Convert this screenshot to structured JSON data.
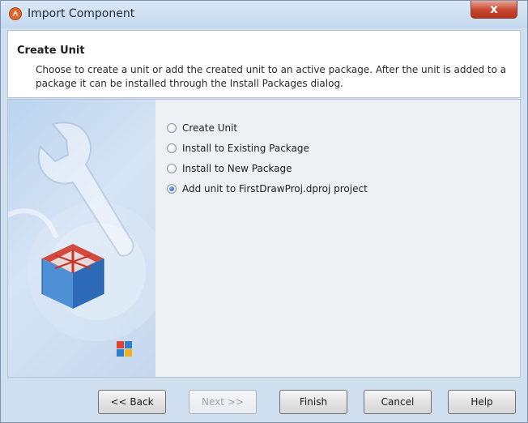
{
  "window": {
    "title": "Import Component",
    "app_icon": "wizard-app-icon",
    "close_glyph": "x"
  },
  "header": {
    "title": "Create Unit",
    "description": "Choose to create a unit or add the created unit to an active package. After the unit is added to a package it can be installed through the Install Packages dialog."
  },
  "options": [
    {
      "label": "Create Unit",
      "selected": false
    },
    {
      "label": "Install to Existing Package",
      "selected": false
    },
    {
      "label": "Install to New Package",
      "selected": false
    },
    {
      "label": "Add unit to FirstDrawProj.dproj project",
      "selected": true
    }
  ],
  "buttons": {
    "back": "<< Back",
    "next": "Next >>",
    "finish": "Finish",
    "cancel": "Cancel",
    "help": "Help"
  },
  "colors": {
    "accent": "#1a56b0",
    "close_button": "#c7462f"
  }
}
